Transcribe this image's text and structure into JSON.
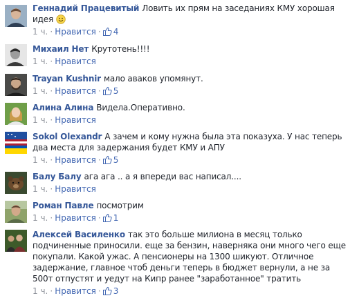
{
  "comments": [
    {
      "author": "Геннадий Працевитый",
      "text": "Ловить их прям на заседаниях КМУ хорошая идея",
      "time": "1 ч.",
      "like_label": "Нравится",
      "likes": "4",
      "avatar": "man-portrait-avatar",
      "has_emoji": true,
      "emoji": "smile-emoji-icon"
    },
    {
      "author": "Михаил Нет",
      "text": "Крутотень!!!!",
      "time": "1 ч.",
      "like_label": "Нравится",
      "likes": "",
      "avatar": "black-white-portrait-avatar"
    },
    {
      "author": "Trayan Kushnir",
      "text": "мало аваков упомянут.",
      "time": "1 ч.",
      "like_label": "Нравится",
      "likes": "5",
      "avatar": "bearded-man-avatar"
    },
    {
      "author": "Алина Алина",
      "text": "Видела.Оперативно.",
      "time": "1 ч.",
      "like_label": "Нравится",
      "likes": "",
      "avatar": "woman-green-background-avatar"
    },
    {
      "author": "Sokol Olexandr",
      "text": "А зачем и кому нужна была эта показуха. У нас теперь два места для задержания будет КМУ и АПУ",
      "time": "1 ч.",
      "like_label": "Нравится",
      "likes": "5",
      "avatar": "flags-avatar"
    },
    {
      "author": "Балу Балу",
      "text": "ага ага .. а я впереди вас написал....",
      "time": "1 ч.",
      "like_label": "Нравится",
      "likes": "",
      "avatar": "bear-avatar"
    },
    {
      "author": "Роман Павле",
      "text": "посмотрим",
      "time": "1 ч.",
      "like_label": "Нравится",
      "likes": "1",
      "avatar": "man-outdoors-avatar"
    },
    {
      "author": "Алексей Василенко",
      "text": "так это больше милиона в месяц только подчиненные приносили. еще за бензин, наверняка они много чего еще покупали. Какой ужас. А пенсионеры на 1300 шикуют. Отличное задержание, главное чтоб деньги теперь в бюджет вернули, а не за 500т отпустят и уедут на Кипр ранее \"заработанное\" тратить",
      "time": "1 ч.",
      "like_label": "Нравится",
      "likes": "3",
      "avatar": "group-photo-avatar"
    }
  ],
  "colors": {
    "author_link": "#365899",
    "meta_gray": "#90949c",
    "like_blue": "#4267b2"
  },
  "icons": {
    "thumb": "thumbs-up-icon"
  }
}
